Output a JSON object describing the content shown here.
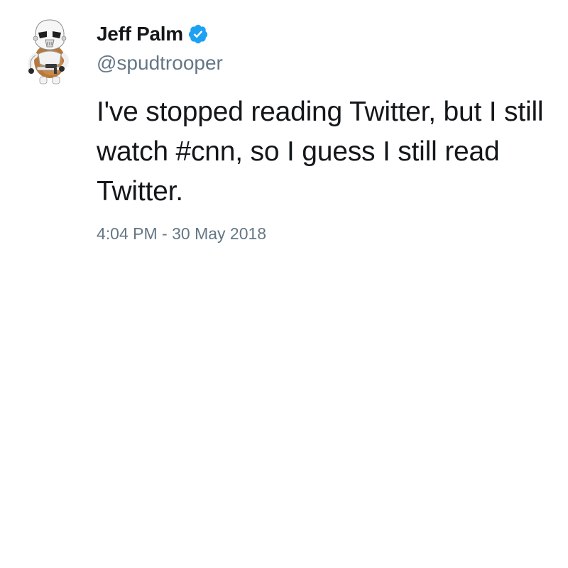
{
  "tweet": {
    "author": {
      "display_name": "Jeff Palm",
      "handle": "@spudtrooper",
      "verified": true,
      "avatar_icon": "stormtrooper-potato-avatar",
      "verified_icon": "verified-badge-icon"
    },
    "text": "I've stopped reading Twitter, but I still watch #cnn, so I guess I still read Twitter.",
    "timestamp": "4:04 PM - 30 May 2018"
  },
  "colors": {
    "text_primary": "#14171a",
    "text_secondary": "#657786",
    "verified_blue": "#1da1f2",
    "background": "#ffffff"
  }
}
